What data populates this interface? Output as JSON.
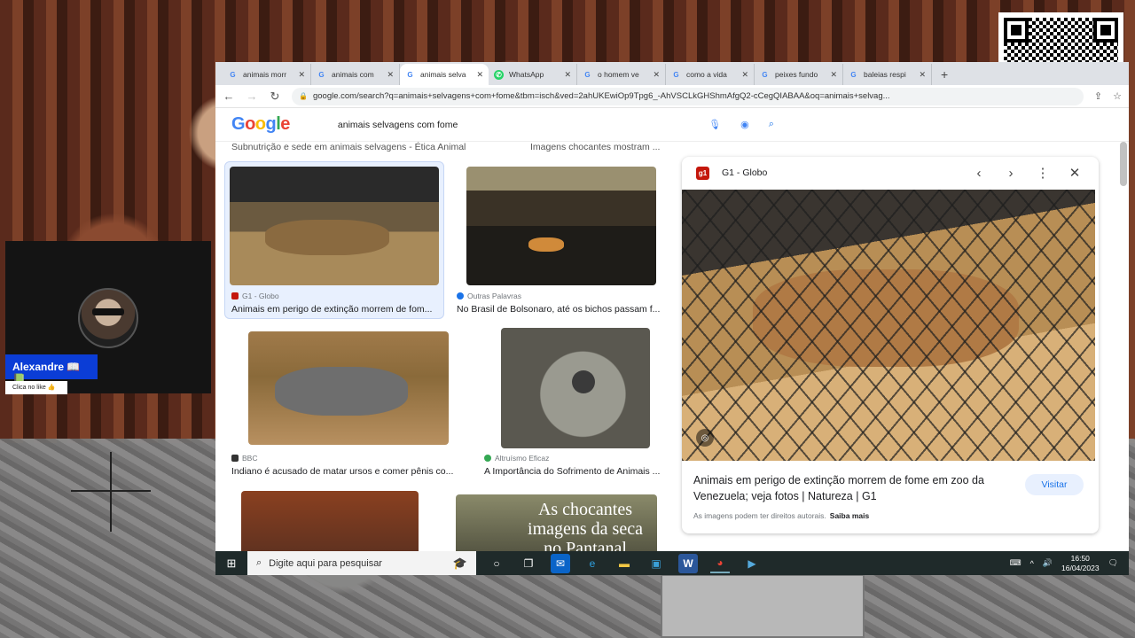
{
  "browser": {
    "tabs": [
      {
        "label": "animais morr",
        "icon": "google-icon",
        "active": false
      },
      {
        "label": "animais com",
        "icon": "google-icon",
        "active": false
      },
      {
        "label": "animais selva",
        "icon": "google-icon",
        "active": true
      },
      {
        "label": "WhatsApp",
        "icon": "whatsapp-icon",
        "active": false
      },
      {
        "label": "o homem ve",
        "icon": "google-icon",
        "active": false
      },
      {
        "label": "como a vida",
        "icon": "google-icon",
        "active": false
      },
      {
        "label": "peixes fundo",
        "icon": "google-icon",
        "active": false
      },
      {
        "label": "baleias respi",
        "icon": "google-icon",
        "active": false
      }
    ],
    "url": "google.com/search?q=animais+selvagens+com+fome&tbm=isch&ved=2ahUKEwiOp9Tpg6_-AhVSCLkGHShmAfgQ2-cCegQIABAA&oq=animais+selvag..."
  },
  "google": {
    "logo_letters": [
      "G",
      "o",
      "o",
      "g",
      "l",
      "e"
    ],
    "query": "animais selvagens com fome"
  },
  "results": {
    "top_texts": [
      "Subnutrição e sede em animais selvagens - Ética Animal",
      "Imagens chocantes mostram ..."
    ],
    "cards": [
      {
        "source": "G1 - Globo",
        "title": "Animais em perigo de extinção morrem de fom...",
        "source_color": "#c4170c"
      },
      {
        "source": "Outras Palavras",
        "title": "No Brasil de Bolsonaro, até os bichos passam f...",
        "source_color": "#1a73e8"
      },
      {
        "source": "BBC",
        "title": "Indiano é acusado de matar ursos e comer pênis co...",
        "source_color": "#333333"
      },
      {
        "source": "Altruísmo Eficaz",
        "title": "A Importância do Sofrimento de Animais ...",
        "source_color": "#34a853"
      }
    ],
    "overlay_text": "As chocantes imagens da seca no Pantanal"
  },
  "panel": {
    "source": "G1 - Globo",
    "source_badge": "g1",
    "title": "Animais em perigo de extinção morrem de fome em zoo da Venezuela; veja fotos | Natureza | G1",
    "visit_label": "Visitar",
    "note": "As imagens podem ter direitos autorais.",
    "note_link": "Saiba mais"
  },
  "streamer": {
    "name": "Alexandre 📖📗",
    "like_text": "Clica no like 👍"
  },
  "taskbar": {
    "search_placeholder": "Digite aqui para pesquisar",
    "time": "16:50",
    "date": "16/04/2023"
  }
}
